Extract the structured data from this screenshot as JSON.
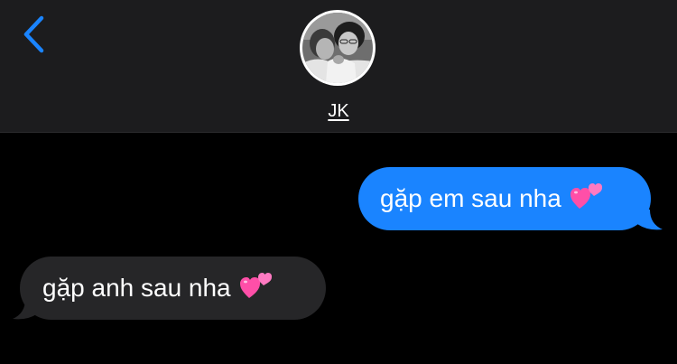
{
  "header": {
    "contact_name": "JK",
    "back_icon": "chevron-left-icon",
    "accent_color": "#1a84ff"
  },
  "messages": [
    {
      "direction": "sent",
      "text": "gặp em sau nha",
      "emoji": "two-hearts-icon"
    },
    {
      "direction": "received",
      "text": "gặp anh sau nha",
      "emoji": "two-hearts-icon"
    }
  ],
  "colors": {
    "sent_bubble": "#1a84ff",
    "received_bubble": "#262628",
    "header_bg": "#1c1c1e",
    "background": "#000000"
  }
}
